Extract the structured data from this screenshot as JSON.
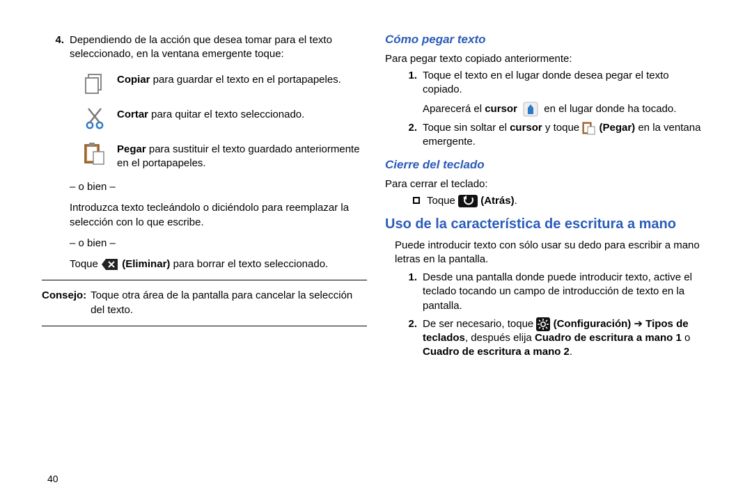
{
  "pageNumber": "40",
  "left": {
    "item4": {
      "num": "4.",
      "text": "Dependiendo de la acción que desea tomar para el texto seleccionado, en la ventana emergente toque:"
    },
    "copy": {
      "b": "Copiar",
      "rest": " para guardar el texto en el portapapeles."
    },
    "cut": {
      "b": "Cortar",
      "rest": " para quitar el texto seleccionado."
    },
    "paste": {
      "b": "Pegar",
      "rest": " para sustituir el texto guardado anteriormente en el portapapeles."
    },
    "or1": "– o bien –",
    "typeReplace": "Introduzca texto tecleándolo o diciéndolo para reemplazar la selección con lo que escribe.",
    "or2": "– o bien –",
    "tapDelete_pre": "Toque ",
    "tapDelete_b": " (Eliminar)",
    "tapDelete_post": " para borrar el texto seleccionado.",
    "tipLabel": "Consejo:",
    "tipText": "Toque otra área de la pantalla para cancelar la selección del texto."
  },
  "right": {
    "h_paste": "Cómo pegar texto",
    "paste_intro": "Para pegar texto copiado anteriormente:",
    "p1": {
      "num": "1.",
      "text": "Toque el texto en el lugar donde desea pegar el texto copiado."
    },
    "p1b_pre": "Aparecerá el ",
    "p1b_b": "cursor",
    "p1b_post": " en el lugar donde ha tocado.",
    "p2": {
      "num": "2.",
      "pre": "Toque sin soltar el ",
      "b1": "cursor",
      "mid": " y toque ",
      "b2": " (Pegar)",
      "post": " en la ventana emergente."
    },
    "h_close": "Cierre del teclado",
    "close_intro": "Para cerrar el teclado:",
    "close_tap_pre": "Toque ",
    "close_tap_b": " (Atrás)",
    "close_tap_post": ".",
    "h_hand": "Uso de la característica de escritura a mano",
    "hand_intro": "Puede introducir texto con sólo usar su dedo para escribir a mano letras en la pantalla.",
    "h1": {
      "num": "1.",
      "text": "Desde una pantalla donde puede introducir texto, active el teclado tocando un campo de introducción de texto en la pantalla."
    },
    "h2": {
      "num": "2.",
      "pre": "De ser necesario, toque ",
      "b1": " (Configuración)",
      "arrow": " ➔ ",
      "b2": "Tipos de teclados",
      "mid": ", después elija ",
      "b3": "Cuadro de escritura a mano 1",
      "mid2": " o ",
      "b4": "Cuadro de escritura a mano 2",
      "post": "."
    }
  }
}
